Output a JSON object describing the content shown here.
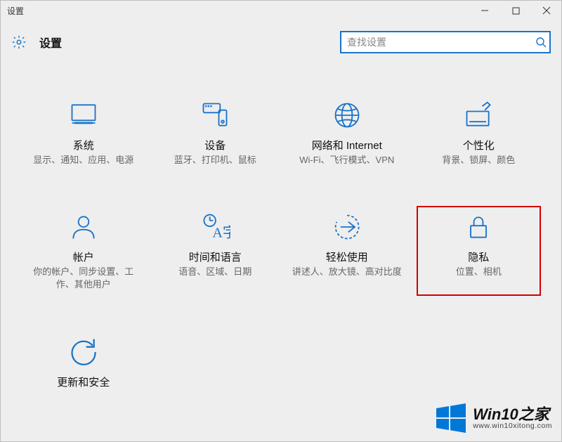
{
  "window": {
    "title": "设置"
  },
  "header": {
    "title": "设置"
  },
  "search": {
    "placeholder": "查找设置"
  },
  "tiles": {
    "system": {
      "title": "系统",
      "desc": "显示、通知、应用、电源"
    },
    "devices": {
      "title": "设备",
      "desc": "蓝牙、打印机、鼠标"
    },
    "network": {
      "title": "网络和 Internet",
      "desc": "Wi-Fi、飞行模式、VPN"
    },
    "personal": {
      "title": "个性化",
      "desc": "背景、锁屏、颜色"
    },
    "accounts": {
      "title": "帐户",
      "desc": "你的帐户、同步设置、工作、其他用户"
    },
    "timelang": {
      "title": "时间和语言",
      "desc": "语音、区域、日期"
    },
    "ease": {
      "title": "轻松使用",
      "desc": "讲述人、放大镜、高对比度"
    },
    "privacy": {
      "title": "隐私",
      "desc": "位置、相机"
    },
    "update": {
      "title": "更新和安全",
      "desc": ""
    }
  },
  "watermark": {
    "brand": "Win10之家",
    "url": "www.win10xitong.com"
  },
  "colors": {
    "accent": "#1a73c9",
    "highlight": "#d40000"
  }
}
